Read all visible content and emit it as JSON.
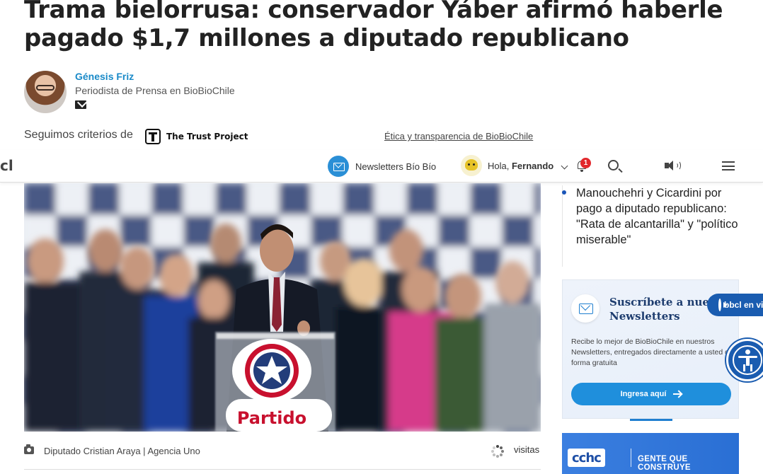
{
  "article": {
    "headline": "Trama bielorrusa: conservador Yáber afirmó haberle pagado $1,7 millones a diputado republicano",
    "author": {
      "name": "Génesis Friz",
      "role": "Periodista de Prensa en BioBioChile"
    },
    "trust_prefix": "Seguimos criterios de",
    "trust_project": "The Trust Project",
    "ethics_link": "Ética y transparencia de BioBioChile"
  },
  "navbar": {
    "logo_fragment": "cl",
    "newsletters": "Newsletters Bío Bío",
    "greeting": "Hola,",
    "user": "Fernando",
    "notifications_count": "1"
  },
  "photo": {
    "sign_text": "Partido",
    "caption": "Diputado Cristian Araya | Agencia Uno",
    "visits_label": "visitas"
  },
  "sidebar": {
    "related_title": "Manouchehri y Cicardini por pago a diputado republicano: \"Rata de alcantarilla\" y \"político miserable\"",
    "promo": {
      "title_line1": "Suscríbete a nuestros",
      "title_line2": "Newsletters",
      "description": "Recibe lo mejor de BioBioChile en nuestros Newsletters, entregados directamente a usted de forma gratuita",
      "button": "Ingresa aquí"
    },
    "bbcl_pill": "bbcl en vivo",
    "ad": {
      "logo": "cchc",
      "tagline": "GENTE QUE CONSTRUYE"
    }
  },
  "colors": {
    "link_blue": "#1a8ac8",
    "nav_blue": "#2a8fd6",
    "badge_red": "#e2282c",
    "accent_navy": "#1a5cb0"
  }
}
